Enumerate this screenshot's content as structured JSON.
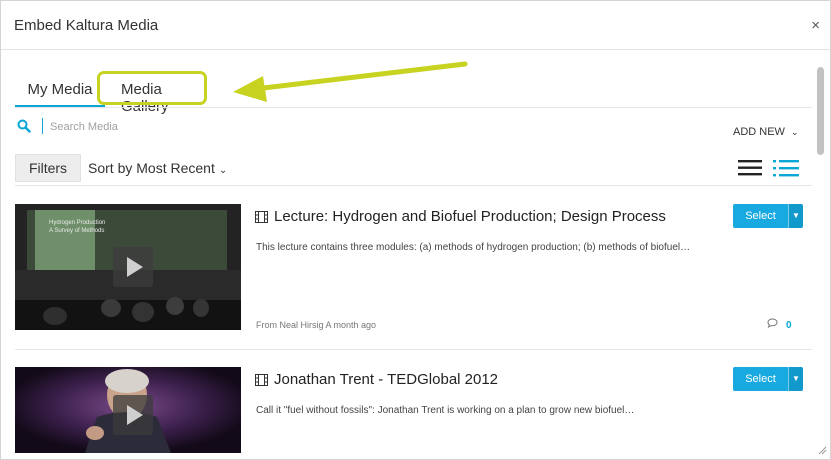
{
  "dialog": {
    "title": "Embed Kaltura Media",
    "close": "×"
  },
  "tabs": [
    {
      "label": "My Media",
      "active": true
    },
    {
      "label": "Media Gallery",
      "active": false
    }
  ],
  "search": {
    "placeholder": "Search Media",
    "value": ""
  },
  "add_new": {
    "label": "ADD NEW",
    "chevron": "⌄"
  },
  "toolbar": {
    "filters_label": "Filters",
    "sort_label": "Sort by Most Recent",
    "sort_chevron": "⌄"
  },
  "colors": {
    "accent": "#0aa6d6",
    "select_button": "#17a9e0",
    "highlight": "#c7d320"
  },
  "media": [
    {
      "title": "Lecture: Hydrogen and Biofuel Production; Design Process",
      "description": "This lecture contains three modules: (a) methods of hydrogen production; (b) methods of biofuel…",
      "meta": "From Neal Hirsig A month ago",
      "comments": "0",
      "select_label": "Select",
      "thumbnail_slide_text": [
        "Hydrogen Production",
        "A Survey of Methods"
      ]
    },
    {
      "title": "Jonathan Trent - TEDGlobal 2012",
      "description": "Call it \"fuel without fossils\": Jonathan Trent is working on a plan to grow new biofuel…",
      "select_label": "Select"
    }
  ],
  "icons": {
    "search": "search-icon",
    "film": "film-icon",
    "comment": "comment-icon",
    "list_view": "list-view-icon",
    "detail_view": "detailed-list-view-icon",
    "close": "close-icon"
  }
}
